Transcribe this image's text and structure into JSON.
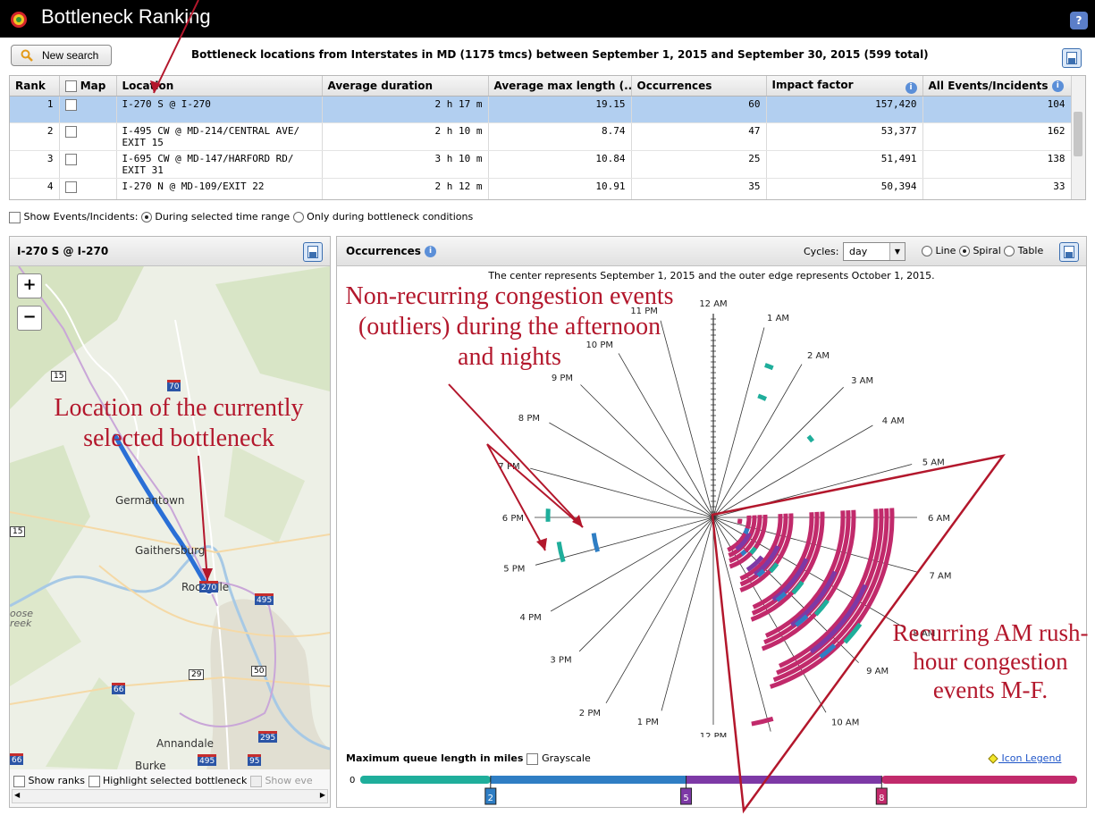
{
  "app": {
    "title": "Bottleneck Ranking"
  },
  "toolbar": {
    "new_search_label": "New search",
    "summary": "Bottleneck locations from  Interstates in MD (1175 tmcs) between September 1, 2015 and September 30, 2015 (599 total)"
  },
  "table": {
    "columns": [
      "Rank",
      "Map",
      "Location",
      "Average duration",
      "Average max length (...",
      "Occurrences",
      "Impact factor",
      "All Events/Incidents"
    ],
    "rows": [
      {
        "rank": "1",
        "location": "I-270 S @ I-270",
        "duration": "2 h 17 m",
        "maxlen": "19.15",
        "occurrences": "60",
        "impact": "157,420",
        "events": "104",
        "selected": true
      },
      {
        "rank": "2",
        "location": "I-495 CW @ MD-214/CENTRAL AVE/ EXIT 15",
        "duration": "2 h 10 m",
        "maxlen": "8.74",
        "occurrences": "47",
        "impact": "53,377",
        "events": "162",
        "selected": false
      },
      {
        "rank": "3",
        "location": "I-695 CW @ MD-147/HARFORD RD/ EXIT 31",
        "duration": "3 h 10 m",
        "maxlen": "10.84",
        "occurrences": "25",
        "impact": "51,491",
        "events": "138",
        "selected": false
      },
      {
        "rank": "4",
        "location": "I-270 N @ MD-109/EXIT 22",
        "duration": "2 h 12 m",
        "maxlen": "10.91",
        "occurrences": "35",
        "impact": "50,394",
        "events": "33",
        "selected": false
      }
    ]
  },
  "options": {
    "show_events_label": "Show Events/Incidents:",
    "during_label": "During selected time range",
    "only_label": "Only during bottleneck conditions"
  },
  "map": {
    "title": "I-270 S @ I-270",
    "zoom_in": "+",
    "zoom_out": "−",
    "places": [
      "Germantown",
      "Gaithersburg",
      "Rockville",
      "Annandale",
      "Burke",
      "oose",
      "reek"
    ],
    "shields": [
      "15",
      "70",
      "15",
      "270",
      "495",
      "29",
      "50",
      "66",
      "295",
      "495",
      "95",
      "66"
    ],
    "show_ranks_label": "Show ranks",
    "highlight_label": "Highlight selected bottleneck",
    "show_eve_label": "Show eve"
  },
  "chart": {
    "title": "Occurrences",
    "cycles_label": "Cycles:",
    "cycles_value": "day",
    "mode_line": "Line",
    "mode_spiral": "Spiral",
    "mode_table": "Table",
    "subtitle": "The center represents September 1, 2015 and the outer edge represents October 1, 2015.",
    "legend_title": "Maximum queue length in miles",
    "grayscale_label": "Grayscale",
    "icon_legend": "Icon Legend",
    "scale_ticks": [
      "0",
      "2",
      "5",
      "8"
    ]
  },
  "chart_data": {
    "type": "spiral",
    "cycle": "day",
    "hour_labels": [
      "12 AM",
      "1 AM",
      "2 AM",
      "3 AM",
      "4 AM",
      "5 AM",
      "6 AM",
      "7 AM",
      "8 AM",
      "9 AM",
      "10 AM",
      "11 AM",
      "12 PM",
      "1 PM",
      "2 PM",
      "3 PM",
      "4 PM",
      "5 PM",
      "6 PM",
      "7 PM",
      "8 PM",
      "9 PM",
      "10 PM",
      "11 PM"
    ],
    "radial_range": [
      "2015-09-01",
      "2015-10-01"
    ],
    "color_scale": [
      {
        "from": 0,
        "to": 2,
        "color": "#1fae9b"
      },
      {
        "from": 2,
        "to": 5,
        "color": "#2f7ec4"
      },
      {
        "from": 5,
        "to": 8,
        "color": "#7d39a6"
      },
      {
        "from": 8,
        "to": null,
        "color": "#c12a6b"
      }
    ]
  },
  "annotations": {
    "a1": "Non-recurring congestion events (outliers) during the afternoon and nights",
    "a2": "Location of the currently selected bottleneck",
    "a3": "Recurring AM rush-hour congestion events M-F."
  },
  "colors": {
    "annotation": "#b3172c",
    "selected_row": "#b2cff0",
    "route": "#2a6fd6"
  }
}
